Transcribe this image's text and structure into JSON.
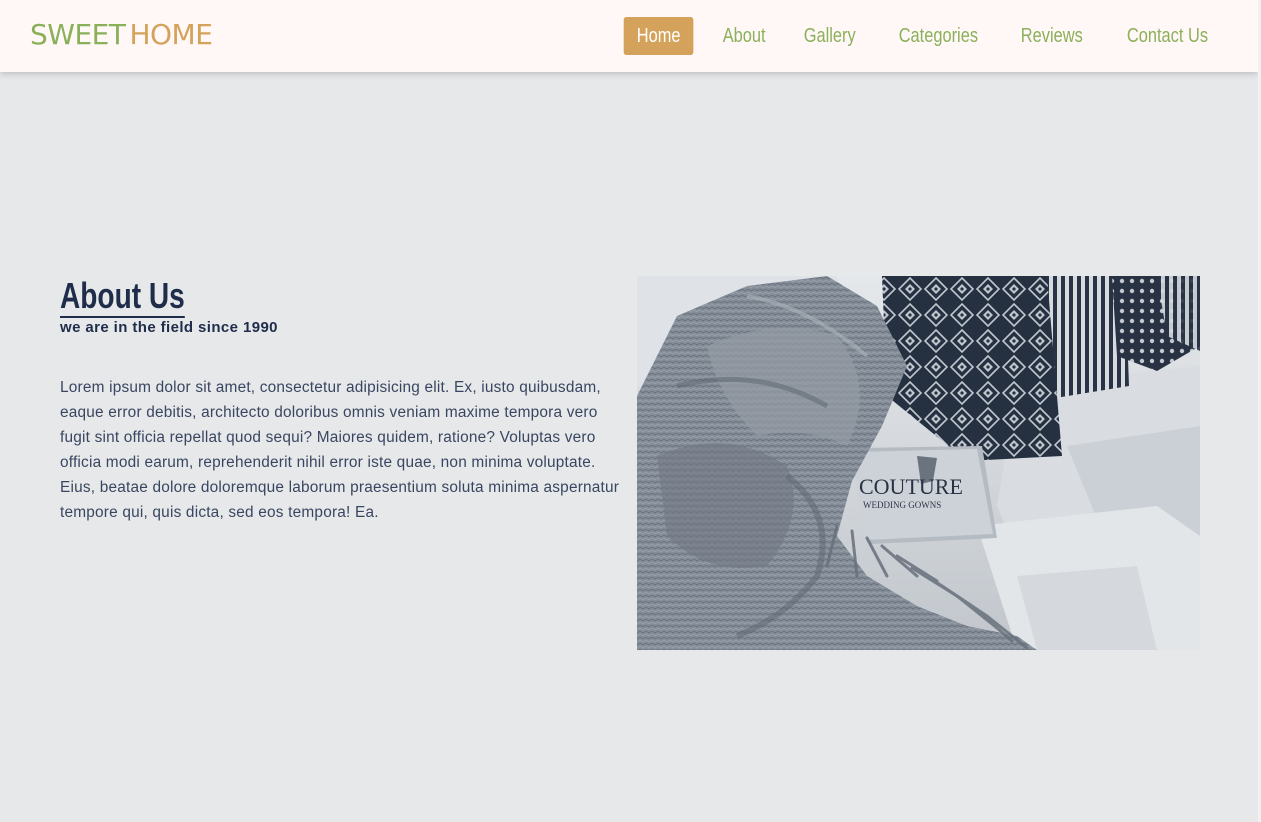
{
  "header": {
    "logo": {
      "word1": "SWEET",
      "word2": "HOME"
    },
    "nav": [
      {
        "label": "Home",
        "active": true
      },
      {
        "label": "About",
        "active": false
      },
      {
        "label": "Gallery",
        "active": false
      },
      {
        "label": "Categories",
        "active": false
      },
      {
        "label": "Reviews",
        "active": false
      },
      {
        "label": "Contact Us",
        "active": false
      }
    ]
  },
  "about": {
    "title": "About Us",
    "subtitle": "we are in the field since 1990",
    "paragraph": "Lorem ipsum dolor sit amet, consectetur adipisicing elit. Ex, iusto quibusdam, eaque error debitis, architecto doloribus omnis veniam maxime tempora vero fugit sint officia repellat quod sequi? Maiores quidem, ratione? Voluptas vero officia modi earum, reprehenderit nihil error iste quae, non minima voluptate. Eius, beatae dolore doloremque laborum praesentium soluta minima aspernatur tempore qui, quis dicta, sed eos tempora! Ea.",
    "image": {
      "book_cover_text": "COUTURE",
      "book_cover_subtext": "WEDDING GOWNS"
    }
  },
  "colors": {
    "accent_green": "#8bb05a",
    "accent_gold": "#d4a25a",
    "navy": "#1f2d4a",
    "page_bg": "#e6e8ea",
    "header_bg": "#fff8f7"
  }
}
